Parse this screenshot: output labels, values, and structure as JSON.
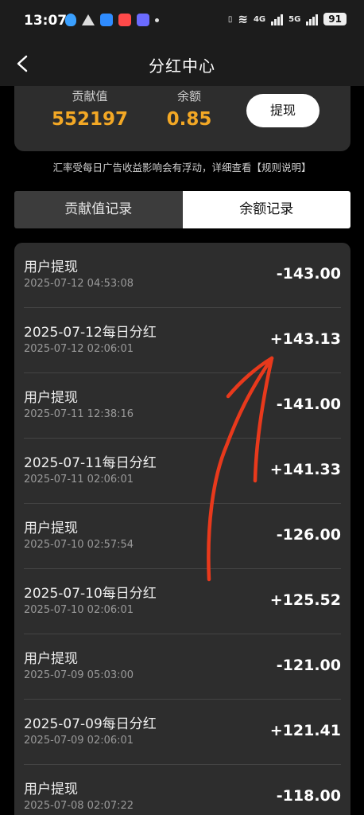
{
  "status_bar": {
    "time": "13:07",
    "net1": "4G",
    "net2": "5G",
    "battery": "91"
  },
  "header": {
    "title": "分红中心"
  },
  "summary": {
    "contribution_label": "贡献值",
    "contribution_value": "552197",
    "balance_label": "余额",
    "balance_value": "0.85",
    "withdraw_label": "提现",
    "value_color": "#f3a825"
  },
  "note": "汇率受每日广告收益影响会有浮动，详细查看【规则说明】",
  "tabs": [
    {
      "label": "贡献值记录",
      "active": false
    },
    {
      "label": "余额记录",
      "active": true
    }
  ],
  "records": [
    {
      "title": "用户提现",
      "time": "2025-07-12 04:53:08",
      "amount": "-143.00"
    },
    {
      "title": "2025-07-12每日分红",
      "time": "2025-07-12 02:06:01",
      "amount": "+143.13"
    },
    {
      "title": "用户提现",
      "time": "2025-07-11 12:38:16",
      "amount": "-141.00"
    },
    {
      "title": "2025-07-11每日分红",
      "time": "2025-07-11 02:06:01",
      "amount": "+141.33"
    },
    {
      "title": "用户提现",
      "time": "2025-07-10 02:57:54",
      "amount": "-126.00"
    },
    {
      "title": "2025-07-10每日分红",
      "time": "2025-07-10 02:06:01",
      "amount": "+125.52"
    },
    {
      "title": "用户提现",
      "time": "2025-07-09 05:03:00",
      "amount": "-121.00"
    },
    {
      "title": "2025-07-09每日分红",
      "time": "2025-07-09 02:06:01",
      "amount": "+121.41"
    },
    {
      "title": "用户提现",
      "time": "2025-07-08 02:07:22",
      "amount": "-118.00"
    }
  ],
  "annotation_color": "#e8391c"
}
